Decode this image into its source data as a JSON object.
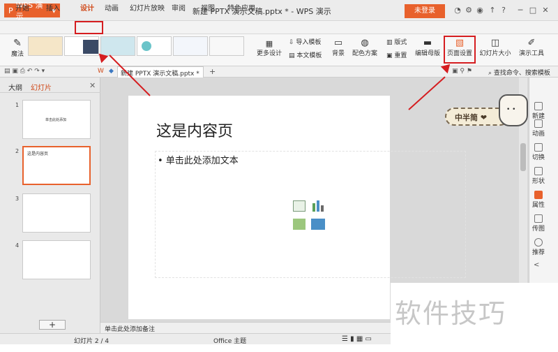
{
  "app": {
    "name": "WPS 演示",
    "title": "新建 PPTX 演示文稿.pptx * - WPS 演示",
    "login": "未登录"
  },
  "menu": {
    "items": [
      "开始",
      "插入",
      "设计",
      "动画",
      "幻灯片放映",
      "审阅",
      "视图",
      "特色应用"
    ],
    "active": "设计"
  },
  "ribbon": {
    "magic": "魔法",
    "more_designs": "更多设计",
    "import_template": "导入模板",
    "text_template": "本文模板",
    "background": "背景",
    "color_scheme": "配色方案",
    "layout": "版式",
    "reset": "重置",
    "edit_master": "编辑母版",
    "page_setup": "页面设置",
    "slide_size": "幻灯片大小",
    "presenter_tools": "演示工具"
  },
  "quick": {
    "doc_tab": "新建 PPTX 演示文稿.pptx *",
    "search": "查找命令、搜索模板"
  },
  "left_pane": {
    "tabs": [
      "大纲",
      "幻灯片"
    ],
    "slides": [
      {
        "num": "1",
        "label": "单击此处添加"
      },
      {
        "num": "2",
        "label": "这是内容页"
      },
      {
        "num": "3",
        "label": ""
      },
      {
        "num": "4",
        "label": ""
      }
    ],
    "add": "+"
  },
  "slide": {
    "title": "这是内容页",
    "bullet": "• 单击此处添加文本"
  },
  "right_sidebar": [
    "新建",
    "动画",
    "切换",
    "形状",
    "属性",
    "传图",
    "推荐"
  ],
  "notes": "单击此处添加备注",
  "status": {
    "slide_info": "幻灯片 2 / 4",
    "theme": "Office 主题"
  },
  "badge": "中半简 ❤",
  "watermark": "软件技巧",
  "colors": {
    "accent": "#e8612c",
    "highlight": "#d51d20"
  }
}
